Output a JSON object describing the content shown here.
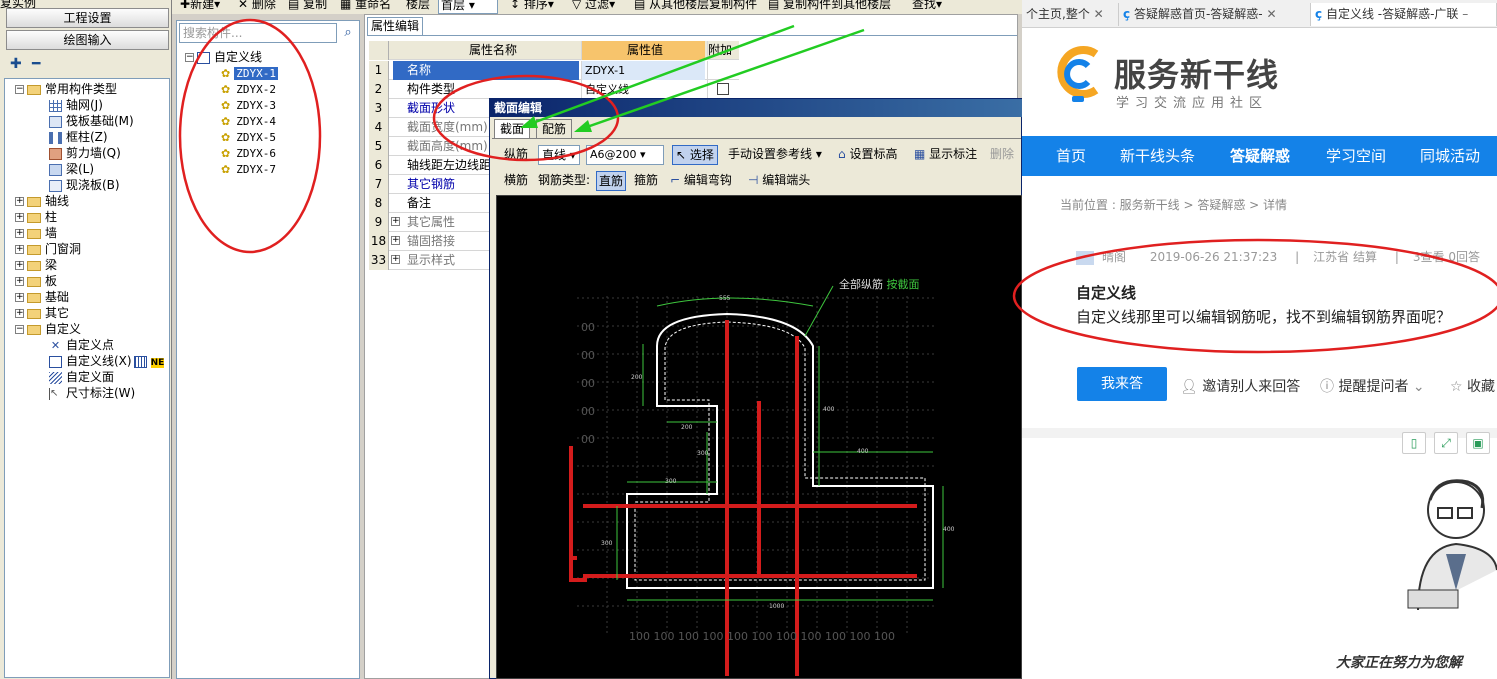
{
  "software": {
    "nav_top_text": "复实例",
    "nav_buttons": [
      "工程设置",
      "绘图输入"
    ],
    "nav_tree": {
      "root": "常用构件类型",
      "root_children": [
        "轴网(J)",
        "筏板基础(M)",
        "框柱(Z)",
        "剪力墙(Q)",
        "梁(L)",
        "现浇板(B)"
      ],
      "groups": [
        "轴线",
        "柱",
        "墙",
        "门窗洞",
        "梁",
        "板",
        "基础",
        "其它"
      ],
      "custom_group": "自定义",
      "custom_children": [
        "自定义点",
        "自定义线(X)",
        "自定义面",
        "尺寸标注(W)"
      ],
      "new_badge": "NE"
    },
    "toolbar": [
      "新建",
      "删除",
      "复制",
      "重命名",
      "楼层",
      "首层",
      "排序",
      "过滤",
      "从其他楼层复制构件",
      "复制构件到其他楼层",
      "查找"
    ],
    "component_list": {
      "search_placeholder": "搜索构件...",
      "root": "自定义线",
      "items": [
        "ZDYX-1",
        "ZDYX-2",
        "ZDYX-3",
        "ZDYX-4",
        "ZDYX-5",
        "ZDYX-6",
        "ZDYX-7"
      ],
      "selected": "ZDYX-1"
    },
    "property_panel": {
      "tab": "属性编辑",
      "headers": [
        "属性名称",
        "属性值",
        "附加"
      ],
      "rows": [
        {
          "num": "1",
          "name": "名称",
          "value": "ZDYX-1",
          "expand": "",
          "color": "#000000"
        },
        {
          "num": "2",
          "name": "构件类型",
          "value": "自定义线",
          "expand": "",
          "color": "#000000"
        },
        {
          "num": "3",
          "name": "截面形状",
          "value": "",
          "expand": "",
          "color": "#0000aa"
        },
        {
          "num": "4",
          "name": "截面宽度(mm)",
          "value": "",
          "expand": "",
          "color": "#777777"
        },
        {
          "num": "5",
          "name": "截面高度(mm)",
          "value": "",
          "expand": "",
          "color": "#777777"
        },
        {
          "num": "6",
          "name": "轴线距左边线距",
          "value": "",
          "expand": "",
          "color": "#000000"
        },
        {
          "num": "7",
          "name": "其它钢筋",
          "value": "",
          "expand": "",
          "color": "#0000aa"
        },
        {
          "num": "8",
          "name": "备注",
          "value": "",
          "expand": "",
          "color": "#000000"
        },
        {
          "num": "9",
          "name": "其它属性",
          "value": "",
          "expand": "+",
          "color": "#777777"
        },
        {
          "num": "18",
          "name": "锚固搭接",
          "value": "",
          "expand": "+",
          "color": "#777777"
        },
        {
          "num": "33",
          "name": "显示样式",
          "value": "",
          "expand": "+",
          "color": "#777777"
        }
      ]
    },
    "section_dialog": {
      "title": "截面编辑",
      "tabs": [
        "截面",
        "配筋"
      ],
      "toolbar1": [
        "纵筋",
        "直线",
        "A6@200",
        "选择",
        "手动设置参考线",
        "设置标高",
        "显示标注",
        "删除"
      ],
      "toolbar2": [
        "横筋",
        "钢筋类型:",
        "直筋",
        "箍筋",
        "编辑弯钩",
        "编辑端头"
      ],
      "canvas_labels": {
        "all_long": "全部纵筋",
        "by_section": "按截面",
        "dims": [
          "555",
          "200",
          "400",
          "200",
          "300",
          "300",
          "400",
          "300",
          "400",
          "1000"
        ],
        "scale_left": "00",
        "scale_bottom": "100"
      }
    }
  },
  "browser": {
    "tabs": [
      "个主页,整个",
      "答疑解惑首页-答疑解惑-",
      "自定义线 -答疑解惑-广联"
    ],
    "logo": {
      "title": "服务新干线",
      "subtitle": "学习交流应用社区"
    },
    "nav": [
      "首页",
      "新干线头条",
      "答疑解惑",
      "学习空间",
      "同城活动"
    ],
    "breadcrumb": "当前位置 :  服务新干线 > 答疑解惑 > 详情",
    "question": {
      "user": "晴阁",
      "date": "2019-06-26 21:37:23",
      "location": "江苏省  结算",
      "stats": "3查看  0回答",
      "title": "自定义线",
      "body": "自定义线那里可以编辑钢筋呢，找不到编辑钢筋界面呢？"
    },
    "actions": {
      "answer": "我来答",
      "invite": "邀请别人来回答",
      "remind": "提醒提问者",
      "collect": "收藏"
    },
    "footer_loading": "大家正在努力为您解"
  },
  "colors": {
    "accent": "#1482e8",
    "annotation_red": "#e02020",
    "annotation_green": "#22cc22"
  }
}
